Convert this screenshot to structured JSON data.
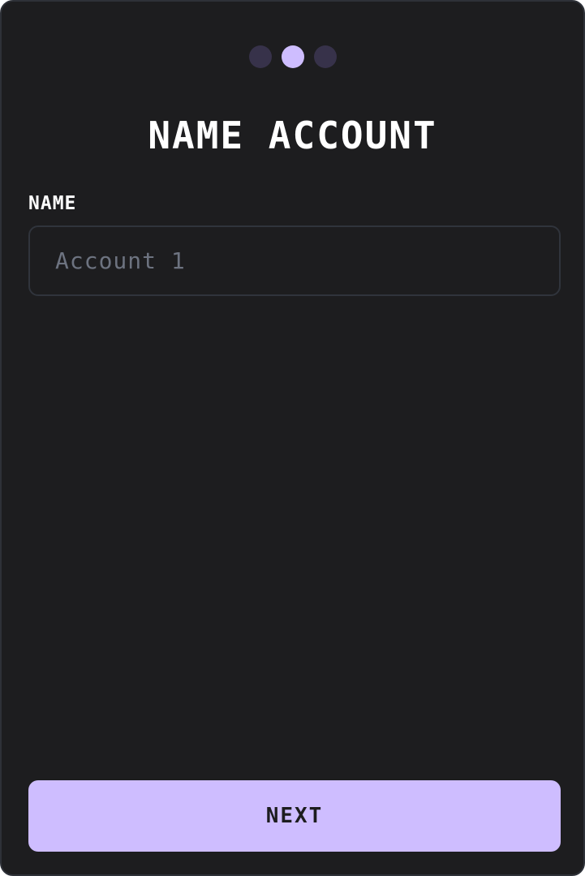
{
  "stepper": {
    "total": 3,
    "current": 2,
    "colors": {
      "active": "#cebdff",
      "inactive": "#37324a"
    }
  },
  "page": {
    "title": "NAME ACCOUNT"
  },
  "form": {
    "name_label": "NAME",
    "name_placeholder": "Account 1",
    "name_value": ""
  },
  "actions": {
    "next_label": "NEXT"
  },
  "theme": {
    "background": "#1d1d1f",
    "accent": "#cebdff",
    "border": "#30343c"
  }
}
